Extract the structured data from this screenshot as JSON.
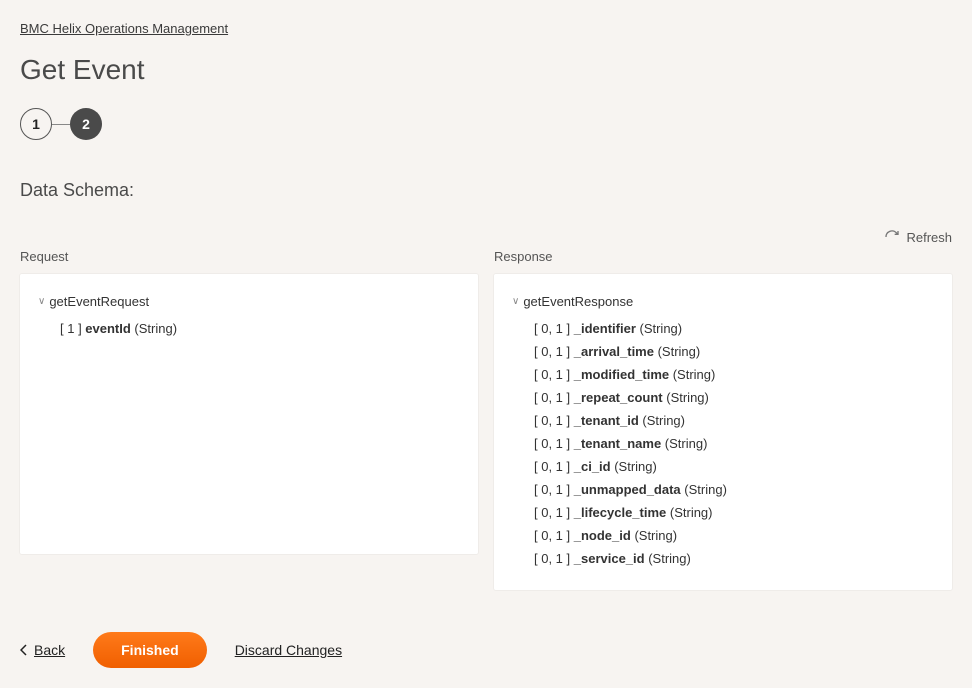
{
  "breadcrumb": "BMC Helix Operations Management",
  "page_title": "Get Event",
  "stepper": {
    "step1": "1",
    "step2": "2"
  },
  "section_title": "Data Schema:",
  "refresh_label": "Refresh",
  "request": {
    "label": "Request",
    "root": "getEventRequest",
    "fields": [
      {
        "card": "[ 1 ]",
        "name": "eventId",
        "type": "(String)"
      }
    ]
  },
  "response": {
    "label": "Response",
    "root": "getEventResponse",
    "fields": [
      {
        "card": "[ 0, 1 ]",
        "name": "_identifier",
        "type": "(String)"
      },
      {
        "card": "[ 0, 1 ]",
        "name": "_arrival_time",
        "type": "(String)"
      },
      {
        "card": "[ 0, 1 ]",
        "name": "_modified_time",
        "type": "(String)"
      },
      {
        "card": "[ 0, 1 ]",
        "name": "_repeat_count",
        "type": "(String)"
      },
      {
        "card": "[ 0, 1 ]",
        "name": "_tenant_id",
        "type": "(String)"
      },
      {
        "card": "[ 0, 1 ]",
        "name": "_tenant_name",
        "type": "(String)"
      },
      {
        "card": "[ 0, 1 ]",
        "name": "_ci_id",
        "type": "(String)"
      },
      {
        "card": "[ 0, 1 ]",
        "name": "_unmapped_data",
        "type": "(String)"
      },
      {
        "card": "[ 0, 1 ]",
        "name": "_lifecycle_time",
        "type": "(String)"
      },
      {
        "card": "[ 0, 1 ]",
        "name": "_node_id",
        "type": "(String)"
      },
      {
        "card": "[ 0, 1 ]",
        "name": "_service_id",
        "type": "(String)"
      }
    ]
  },
  "footer": {
    "back": "Back",
    "finished": "Finished",
    "discard": "Discard Changes"
  }
}
